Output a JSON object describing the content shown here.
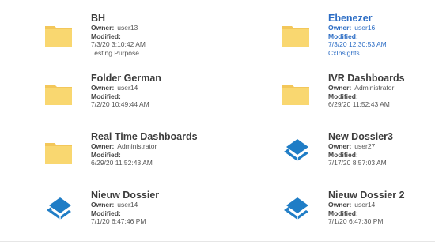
{
  "items": [
    {
      "id": "bh",
      "name": "BH",
      "owner_label": "Owner:",
      "owner": "user13",
      "modified_label": "Modified:",
      "date": "7/3/20 3:10:42 AM",
      "description": "Testing Purpose",
      "icon": "folder-icon",
      "highlighted": false
    },
    {
      "id": "ebenezer",
      "name": "Ebenezer",
      "owner_label": "Owner:",
      "owner": "user16",
      "modified_label": "Modified:",
      "date": "7/3/20 12:30:53 AM",
      "description": "CxInsights",
      "icon": "folder-icon",
      "highlighted": true
    },
    {
      "id": "folder-german",
      "name": "Folder German",
      "owner_label": "Owner:",
      "owner": "user14",
      "modified_label": "Modified:",
      "date": "7/2/20 10:49:44 AM",
      "icon": "folder-icon",
      "highlighted": false
    },
    {
      "id": "ivr-dashboards",
      "name": "IVR Dashboards",
      "owner_label": "Owner:",
      "owner": "Administrator",
      "modified_label": "Modified:",
      "date": "6/29/20 11:52:43 AM",
      "icon": "folder-icon",
      "highlighted": false
    },
    {
      "id": "real-time-dashboards",
      "name": "Real Time Dashboards",
      "owner_label": "Owner:",
      "owner": "Administrator",
      "modified_label": "Modified:",
      "date": "6/29/20 11:52:43 AM",
      "icon": "folder-icon",
      "highlighted": false
    },
    {
      "id": "new-dossier3",
      "name": "New Dossier3",
      "owner_label": "Owner:",
      "owner": "user27",
      "modified_label": "Modified:",
      "date": "7/17/20 8:57:03 AM",
      "icon": "dossier-book-icon",
      "highlighted": false
    },
    {
      "id": "nieuw-dossier",
      "name": "Nieuw Dossier",
      "owner_label": "Owner:",
      "owner": "user14",
      "modified_label": "Modified:",
      "date": "7/1/20 6:47:46 PM",
      "icon": "dossier-book-icon",
      "highlighted": false
    },
    {
      "id": "nieuw-dossier-2",
      "name": "Nieuw Dossier 2",
      "owner_label": "Owner:",
      "owner": "user14",
      "modified_label": "Modified:",
      "date": "7/1/20 6:47:30 PM",
      "icon": "dossier-book-icon",
      "highlighted": false
    }
  ],
  "colors": {
    "folder_fill": "#f9d770",
    "folder_tab": "#f3c75a",
    "dossier_blue": "#1f7dc6",
    "highlight_text": "#2b6cc4"
  }
}
